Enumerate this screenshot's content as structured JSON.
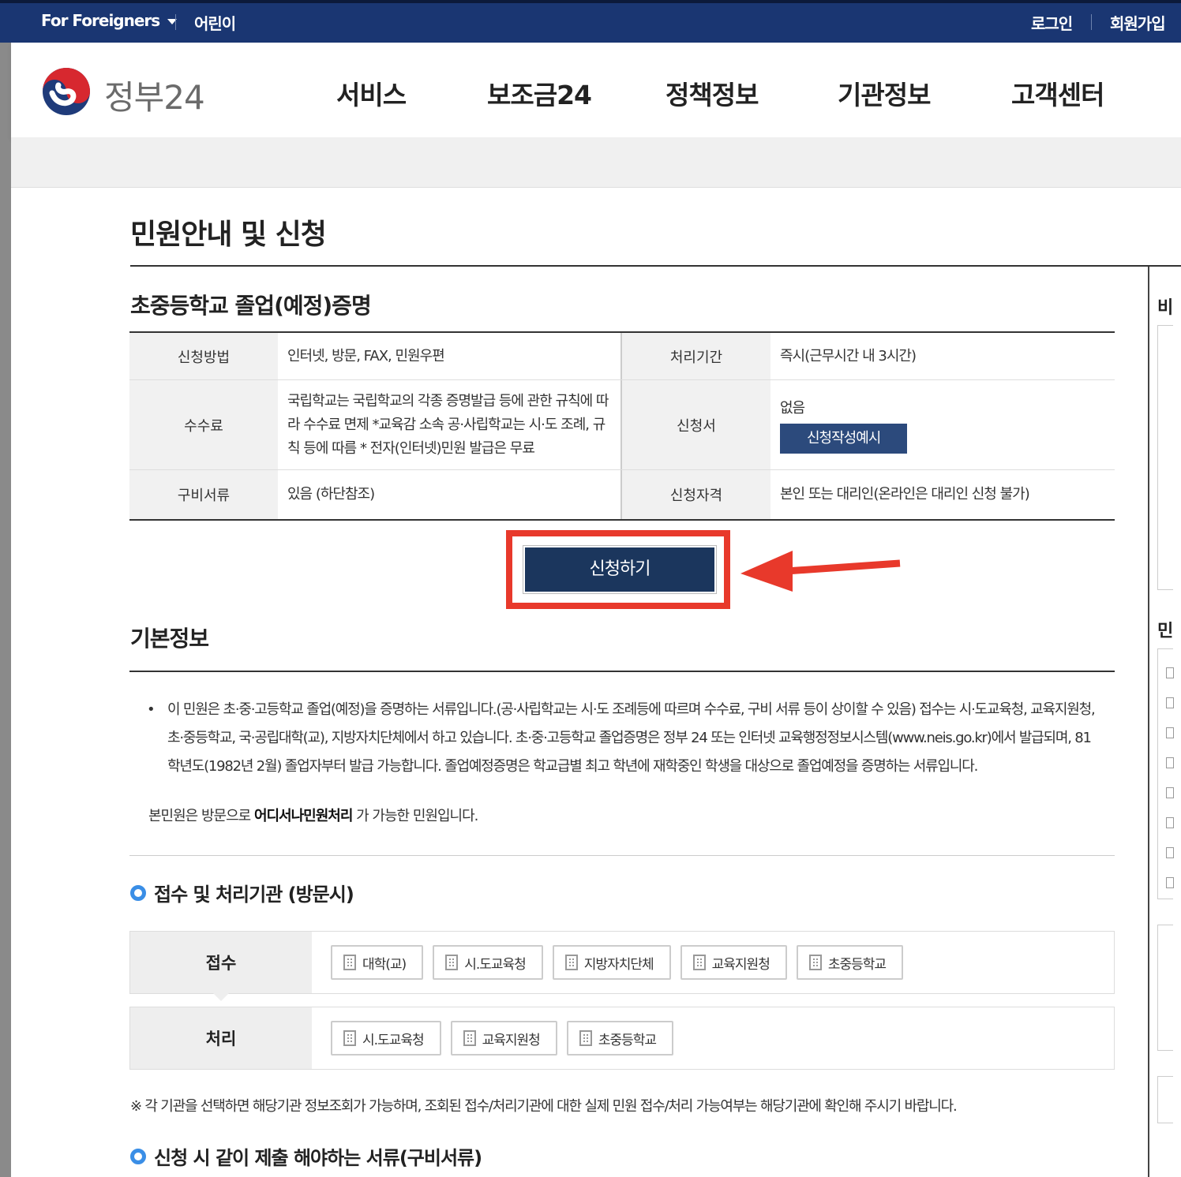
{
  "topbar": {
    "foreigners": "For Foreigners",
    "kids": "어린이",
    "login": "로그인",
    "signup": "회원가입"
  },
  "header": {
    "brand": "정부24",
    "nav": [
      "서비스",
      "보조금24",
      "정책정보",
      "기관정보",
      "고객센터"
    ]
  },
  "page": {
    "title": "민원안내 및 신청",
    "service_name": "초중등학교 졸업(예정)증명"
  },
  "info": {
    "method_label": "신청방법",
    "method_value": "인터넷, 방문, FAX, 민원우편",
    "period_label": "처리기간",
    "period_value": "즉시(근무시간 내 3시간)",
    "fee_label": "수수료",
    "fee_value": "국립학교는 국립학교의 각종 증명발급 등에 관한 규칙에 따라 수수료 면제 *교육감 소속 공·사립학교는 시·도 조례, 규칙 등에 따름 * 전자(인터넷)민원 발급은 무료",
    "form_label": "신청서",
    "form_value": "없음",
    "form_example_button": "신청작성예시",
    "docs_label": "구비서류",
    "docs_value": "있음 (하단참조)",
    "qual_label": "신청자격",
    "qual_value": "본인 또는 대리인(온라인은 대리인 신청 불가)"
  },
  "apply_button": "신청하기",
  "basic": {
    "heading": "기본정보",
    "description": "이 민원은 초·중·고등학교 졸업(예정)을 증명하는 서류입니다.(공·사립학교는 시·도 조례등에 따르며 수수료, 구비 서류 등이 상이할 수 있음) 접수는 시·도교육청, 교육지원청, 초·중등학교, 국·공립대학(교), 지방자치단체에서 하고 있습니다. 초·중·고등학교 졸업증명은 정부 24 또는 인터넷 교육행정정보시스템(www.neis.go.kr)에서 발급되며, 81학년도(1982년 2월) 졸업자부터 발급 가능합니다. 졸업예정증명은 학교급별 최고 학년에 재학중인 학생을 대상으로 졸업예정을 증명하는 서류입니다.",
    "visit_prefix": "본민원은 방문으로 ",
    "visit_bold": "어디서나민원처리",
    "visit_suffix": " 가 가능한 민원입니다."
  },
  "orgs": {
    "heading": "접수 및 처리기관 (방문시)",
    "receive_label": "접수",
    "receive": [
      "대학(교)",
      "시.도교육청",
      "지방자치단체",
      "교육지원청",
      "초중등학교"
    ],
    "process_label": "처리",
    "process": [
      "시.도교육청",
      "교육지원청",
      "초중등학교"
    ],
    "footnote": "※ 각 기관을 선택하면 해당기관 정보조회가 가능하며, 조회된 접수/처리기관에 대한 실제 민원 접수/처리 가능여부는 해당기관에 확인해 주시기 바랍니다."
  },
  "required_docs_heading": "신청 시 같이 제출 해야하는 서류(구비서류)",
  "sidebar": {
    "label_top": "비",
    "label_mid": "민"
  },
  "colors": {
    "topbar": "#1a3672",
    "primary_button": "#1b365d",
    "highlight": "#e8392b",
    "accent_ring": "#3a8ee6"
  }
}
